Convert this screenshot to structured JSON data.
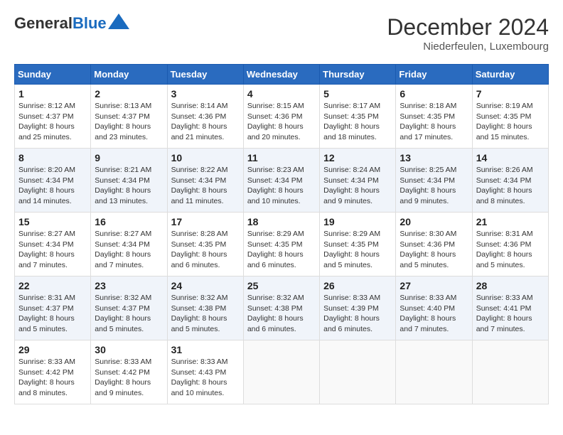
{
  "logo": {
    "line1": "General",
    "line2": "Blue"
  },
  "header": {
    "title": "December 2024",
    "subtitle": "Niederfeulen, Luxembourg"
  },
  "weekdays": [
    "Sunday",
    "Monday",
    "Tuesday",
    "Wednesday",
    "Thursday",
    "Friday",
    "Saturday"
  ],
  "weeks": [
    [
      {
        "day": "1",
        "sunrise": "8:12 AM",
        "sunset": "4:37 PM",
        "daylight": "8 hours and 25 minutes."
      },
      {
        "day": "2",
        "sunrise": "8:13 AM",
        "sunset": "4:37 PM",
        "daylight": "8 hours and 23 minutes."
      },
      {
        "day": "3",
        "sunrise": "8:14 AM",
        "sunset": "4:36 PM",
        "daylight": "8 hours and 21 minutes."
      },
      {
        "day": "4",
        "sunrise": "8:15 AM",
        "sunset": "4:36 PM",
        "daylight": "8 hours and 20 minutes."
      },
      {
        "day": "5",
        "sunrise": "8:17 AM",
        "sunset": "4:35 PM",
        "daylight": "8 hours and 18 minutes."
      },
      {
        "day": "6",
        "sunrise": "8:18 AM",
        "sunset": "4:35 PM",
        "daylight": "8 hours and 17 minutes."
      },
      {
        "day": "7",
        "sunrise": "8:19 AM",
        "sunset": "4:35 PM",
        "daylight": "8 hours and 15 minutes."
      }
    ],
    [
      {
        "day": "8",
        "sunrise": "8:20 AM",
        "sunset": "4:34 PM",
        "daylight": "8 hours and 14 minutes."
      },
      {
        "day": "9",
        "sunrise": "8:21 AM",
        "sunset": "4:34 PM",
        "daylight": "8 hours and 13 minutes."
      },
      {
        "day": "10",
        "sunrise": "8:22 AM",
        "sunset": "4:34 PM",
        "daylight": "8 hours and 11 minutes."
      },
      {
        "day": "11",
        "sunrise": "8:23 AM",
        "sunset": "4:34 PM",
        "daylight": "8 hours and 10 minutes."
      },
      {
        "day": "12",
        "sunrise": "8:24 AM",
        "sunset": "4:34 PM",
        "daylight": "8 hours and 9 minutes."
      },
      {
        "day": "13",
        "sunrise": "8:25 AM",
        "sunset": "4:34 PM",
        "daylight": "8 hours and 9 minutes."
      },
      {
        "day": "14",
        "sunrise": "8:26 AM",
        "sunset": "4:34 PM",
        "daylight": "8 hours and 8 minutes."
      }
    ],
    [
      {
        "day": "15",
        "sunrise": "8:27 AM",
        "sunset": "4:34 PM",
        "daylight": "8 hours and 7 minutes."
      },
      {
        "day": "16",
        "sunrise": "8:27 AM",
        "sunset": "4:34 PM",
        "daylight": "8 hours and 7 minutes."
      },
      {
        "day": "17",
        "sunrise": "8:28 AM",
        "sunset": "4:35 PM",
        "daylight": "8 hours and 6 minutes."
      },
      {
        "day": "18",
        "sunrise": "8:29 AM",
        "sunset": "4:35 PM",
        "daylight": "8 hours and 6 minutes."
      },
      {
        "day": "19",
        "sunrise": "8:29 AM",
        "sunset": "4:35 PM",
        "daylight": "8 hours and 5 minutes."
      },
      {
        "day": "20",
        "sunrise": "8:30 AM",
        "sunset": "4:36 PM",
        "daylight": "8 hours and 5 minutes."
      },
      {
        "day": "21",
        "sunrise": "8:31 AM",
        "sunset": "4:36 PM",
        "daylight": "8 hours and 5 minutes."
      }
    ],
    [
      {
        "day": "22",
        "sunrise": "8:31 AM",
        "sunset": "4:37 PM",
        "daylight": "8 hours and 5 minutes."
      },
      {
        "day": "23",
        "sunrise": "8:32 AM",
        "sunset": "4:37 PM",
        "daylight": "8 hours and 5 minutes."
      },
      {
        "day": "24",
        "sunrise": "8:32 AM",
        "sunset": "4:38 PM",
        "daylight": "8 hours and 5 minutes."
      },
      {
        "day": "25",
        "sunrise": "8:32 AM",
        "sunset": "4:38 PM",
        "daylight": "8 hours and 6 minutes."
      },
      {
        "day": "26",
        "sunrise": "8:33 AM",
        "sunset": "4:39 PM",
        "daylight": "8 hours and 6 minutes."
      },
      {
        "day": "27",
        "sunrise": "8:33 AM",
        "sunset": "4:40 PM",
        "daylight": "8 hours and 7 minutes."
      },
      {
        "day": "28",
        "sunrise": "8:33 AM",
        "sunset": "4:41 PM",
        "daylight": "8 hours and 7 minutes."
      }
    ],
    [
      {
        "day": "29",
        "sunrise": "8:33 AM",
        "sunset": "4:42 PM",
        "daylight": "8 hours and 8 minutes."
      },
      {
        "day": "30",
        "sunrise": "8:33 AM",
        "sunset": "4:42 PM",
        "daylight": "8 hours and 9 minutes."
      },
      {
        "day": "31",
        "sunrise": "8:33 AM",
        "sunset": "4:43 PM",
        "daylight": "8 hours and 10 minutes."
      },
      null,
      null,
      null,
      null
    ]
  ],
  "labels": {
    "sunrise": "Sunrise:",
    "sunset": "Sunset:",
    "daylight": "Daylight:"
  }
}
